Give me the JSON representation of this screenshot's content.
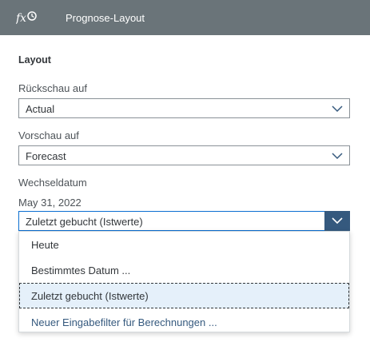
{
  "header": {
    "title": "Prognose-Layout",
    "icon": "formula-clock-icon"
  },
  "layout": {
    "section_title": "Layout",
    "review": {
      "label": "Rückschau auf",
      "value": "Actual"
    },
    "preview": {
      "label": "Vorschau auf",
      "value": "Forecast"
    },
    "switch_date": {
      "label": "Wechseldatum",
      "date": "May 31, 2022",
      "value": "Zuletzt gebucht (Istwerte)",
      "options": [
        "Heute",
        "Bestimmtes Datum ...",
        "Zuletzt gebucht (Istwerte)",
        "Neuer Eingabefilter für Berechnungen ..."
      ]
    }
  },
  "colors": {
    "header_bg": "#6a7479",
    "accent": "#35597e",
    "focus": "#0a6ed1",
    "selected_bg": "#e5f0fa"
  }
}
